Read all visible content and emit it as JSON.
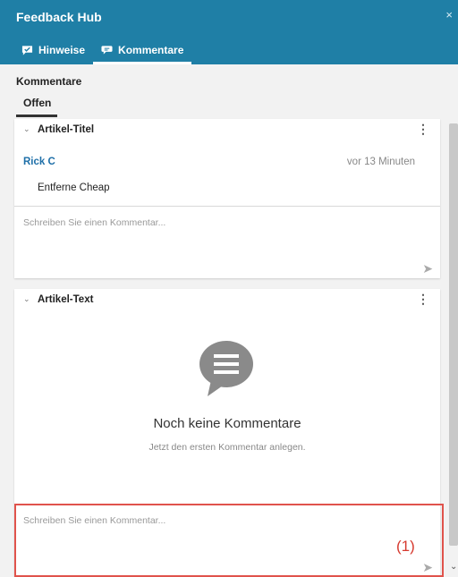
{
  "window": {
    "title": "Feedback Hub",
    "close_glyph": "×"
  },
  "tabs": [
    {
      "label": "Hinweise",
      "icon": "checkmark-chat-icon",
      "active": false
    },
    {
      "label": "Kommentare",
      "icon": "chat-bubble-icon",
      "active": true
    }
  ],
  "section": {
    "title": "Kommentare",
    "subtab": "Offen"
  },
  "cards": [
    {
      "title": "Artikel-Titel",
      "comments": [
        {
          "author": "Rick C",
          "time": "vor 13 Minuten",
          "text": "Entferne Cheap"
        }
      ],
      "composer_placeholder": "Schreiben Sie einen Kommentar..."
    },
    {
      "title": "Artikel-Text",
      "empty_title": "Noch keine Kommentare",
      "empty_subtitle": "Jetzt den ersten Kommentar anlegen.",
      "composer_placeholder": "Schreiben Sie einen Kommentar..."
    }
  ],
  "annotation": {
    "label": "(1)",
    "color": "#e0534c"
  },
  "colors": {
    "header": "#1f7fa6",
    "author": "#1e6fa8"
  }
}
